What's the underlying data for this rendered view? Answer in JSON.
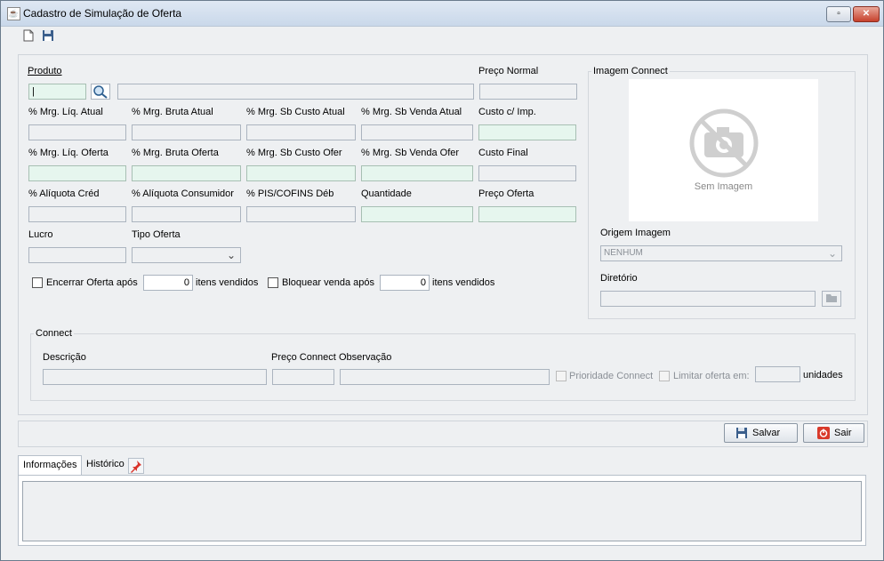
{
  "window": {
    "title": "Cadastro de Simulação de Oferta",
    "icon": "java-cup-icon"
  },
  "toolbar": {
    "new_icon": "new-document-icon",
    "save_icon": "floppy-disk-icon"
  },
  "form": {
    "produto_label": "Produto",
    "preco_normal_label": "Preço Normal",
    "row2": [
      "% Mrg. Líq. Atual",
      "% Mrg. Bruta Atual",
      "% Mrg. Sb Custo Atual",
      "% Mrg. Sb Venda Atual",
      "Custo c/ Imp."
    ],
    "row3": [
      "% Mrg. Líq. Oferta",
      "% Mrg. Bruta Oferta",
      "% Mrg. Sb Custo Ofer",
      "% Mrg. Sb Venda Ofer",
      "Custo Final"
    ],
    "row4": [
      "% Alíquota Créd",
      "% Alíquota Consumidor",
      "% PIS/COFINS Déb",
      "Quantidade",
      "Preço Oferta"
    ],
    "lucro_label": "Lucro",
    "tipo_oferta_label": "Tipo Oferta",
    "encerrar_label": "Encerrar Oferta após",
    "encerrar_value": "0",
    "itens_vendidos_1": "itens vendidos",
    "bloquear_label": "Bloquear venda após",
    "bloquear_value": "0",
    "itens_vendidos_2": "itens vendidos"
  },
  "imagem": {
    "group_title": "Imagem Connect",
    "placeholder_text": "Sem Imagem",
    "origem_label": "Origem Imagem",
    "origem_value": "NENHUM",
    "diretorio_label": "Diretório"
  },
  "connect": {
    "group_title": "Connect",
    "descricao_label": "Descrição",
    "preco_label": "Preço Connect",
    "observacao_label": "Observação",
    "prioridade_label": "Prioridade Connect",
    "limitar_label": "Limitar oferta em:",
    "unidades_label": "unidades"
  },
  "buttons": {
    "salvar": "Salvar",
    "sair": "Sair"
  },
  "tabs": [
    {
      "label": "Informações",
      "active": true
    },
    {
      "label": "Histórico",
      "active": false
    }
  ],
  "colors": {
    "highlight_field": "#e6f6ee",
    "sair_icon": "#d93a2b"
  }
}
